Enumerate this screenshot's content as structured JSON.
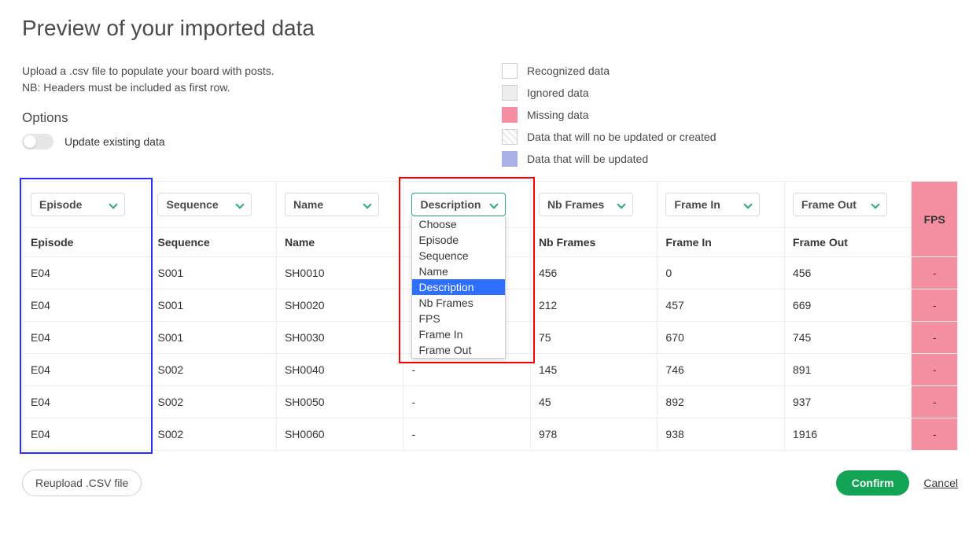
{
  "title": "Preview of your imported data",
  "instructions_line1": "Upload a .csv file to populate your board with posts.",
  "instructions_line2": "NB: Headers must be included as first row.",
  "options_heading": "Options",
  "toggle_label": "Update existing data",
  "legend": {
    "recognized": "Recognized data",
    "ignored": "Ignored data",
    "missing": "Missing data",
    "noupdate": "Data that will no be updated or created",
    "update": "Data that will be updated"
  },
  "columns": {
    "episode": {
      "select": "Episode",
      "label": "Episode"
    },
    "sequence": {
      "select": "Sequence",
      "label": "Sequence"
    },
    "name": {
      "select": "Name",
      "label": "Name"
    },
    "description": {
      "select": "Description",
      "label": "Description"
    },
    "nbframes": {
      "select": "Nb Frames",
      "label": "Nb Frames"
    },
    "framein": {
      "select": "Frame In",
      "label": "Frame In"
    },
    "frameout": {
      "select": "Frame Out",
      "label": "Frame Out"
    },
    "fps": {
      "label": "FPS"
    }
  },
  "dropdown_options": [
    "Choose",
    "Episode",
    "Sequence",
    "Name",
    "Description",
    "Nb Frames",
    "FPS",
    "Frame In",
    "Frame Out"
  ],
  "dropdown_selected": "Description",
  "rows": [
    {
      "episode": "E04",
      "sequence": "S001",
      "name": "SH0010",
      "description": "-",
      "nbframes": "456",
      "framein": "0",
      "frameout": "456",
      "fps": "-"
    },
    {
      "episode": "E04",
      "sequence": "S001",
      "name": "SH0020",
      "description": "-",
      "nbframes": "212",
      "framein": "457",
      "frameout": "669",
      "fps": "-"
    },
    {
      "episode": "E04",
      "sequence": "S001",
      "name": "SH0030",
      "description": "-",
      "nbframes": "75",
      "framein": "670",
      "frameout": "745",
      "fps": "-"
    },
    {
      "episode": "E04",
      "sequence": "S002",
      "name": "SH0040",
      "description": "-",
      "nbframes": "145",
      "framein": "746",
      "frameout": "891",
      "fps": "-"
    },
    {
      "episode": "E04",
      "sequence": "S002",
      "name": "SH0050",
      "description": "-",
      "nbframes": "45",
      "framein": "892",
      "frameout": "937",
      "fps": "-"
    },
    {
      "episode": "E04",
      "sequence": "S002",
      "name": "SH0060",
      "description": "-",
      "nbframes": "978",
      "framein": "938",
      "frameout": "1916",
      "fps": "-"
    }
  ],
  "buttons": {
    "reupload": "Reupload .CSV file",
    "confirm": "Confirm",
    "cancel": "Cancel"
  }
}
